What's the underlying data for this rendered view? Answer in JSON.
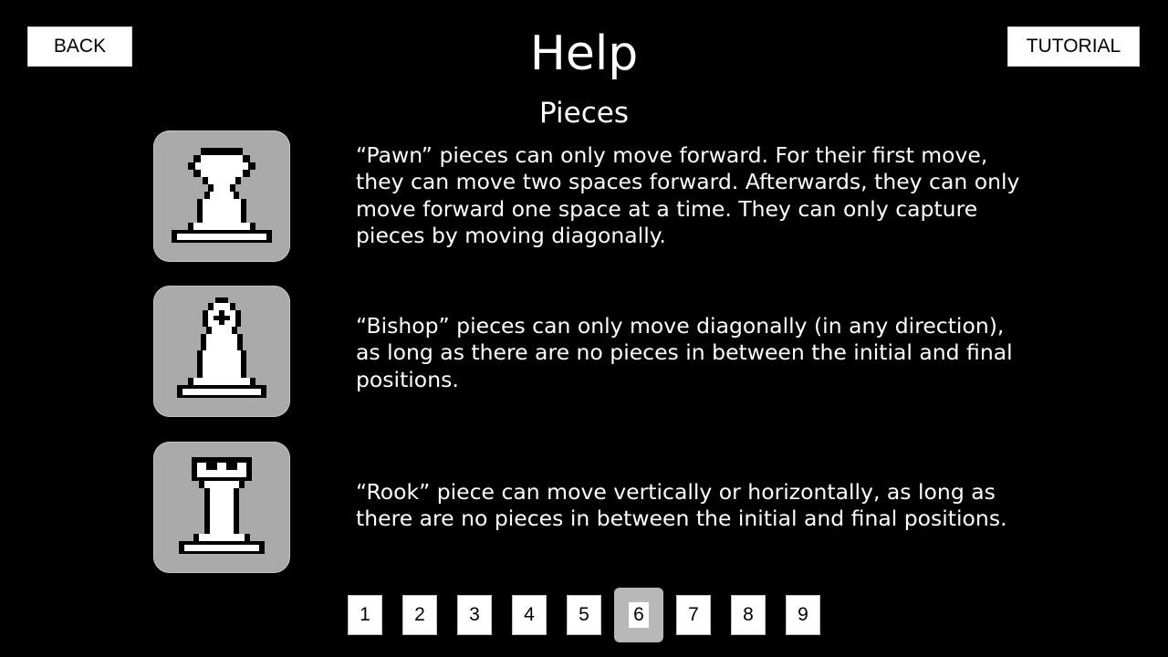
{
  "header": {
    "back_label": "BACK",
    "title": "Help",
    "tutorial_label": "TUTORIAL"
  },
  "section": {
    "title": "Pieces"
  },
  "pieces": [
    {
      "icon": "pawn-icon",
      "description": "“Pawn” pieces can only move forward. For their first move,\nthey can move two spaces forward. Afterwards, they can only\nmove forward one space at a time. They can only capture\npieces by moving diagonally."
    },
    {
      "icon": "bishop-icon",
      "description": "“Bishop” pieces can only move diagonally (in any direction),\nas long as there are no pieces in between the initial and final\npositions."
    },
    {
      "icon": "rook-icon",
      "description": "“Rook” piece can move vertically or horizontally, as long as\nthere are no pieces in between the initial and final positions."
    }
  ],
  "pagination": {
    "pages": [
      "1",
      "2",
      "3",
      "4",
      "5",
      "6",
      "7",
      "8",
      "9"
    ],
    "current": "6"
  },
  "colors": {
    "background": "#000000",
    "card": "#aaaaaa",
    "button": "#ffffff",
    "active_page": "#b8b8b8"
  }
}
